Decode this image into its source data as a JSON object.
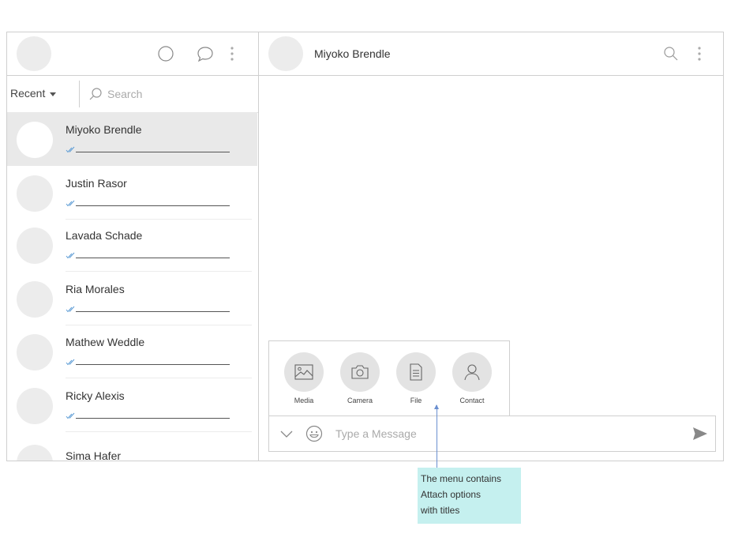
{
  "sidebar": {
    "filter_label": "Recent",
    "search_placeholder": "Search",
    "contacts": [
      {
        "name": "Miyoko Brendle"
      },
      {
        "name": "Justin Rasor"
      },
      {
        "name": "Lavada Schade"
      },
      {
        "name": "Ria Morales"
      },
      {
        "name": "Mathew Weddle"
      },
      {
        "name": "Ricky Alexis"
      },
      {
        "name": "Sima Hafer"
      }
    ]
  },
  "chat": {
    "contact_name": "Miyoko Brendle",
    "message_placeholder": "Type a Message"
  },
  "attach_menu": {
    "options": [
      {
        "label": "Media",
        "icon": "image-icon"
      },
      {
        "label": "Camera",
        "icon": "camera-icon"
      },
      {
        "label": "File",
        "icon": "file-icon"
      },
      {
        "label": "Contact",
        "icon": "person-icon"
      }
    ]
  },
  "annotation": {
    "line1": "The menu contains",
    "line2": "Attach options",
    "line3": "with titles"
  },
  "colors": {
    "read_check": "#5b9bd5",
    "annotation_bg": "#c5f0ef",
    "active_row": "#e9e9e9"
  }
}
